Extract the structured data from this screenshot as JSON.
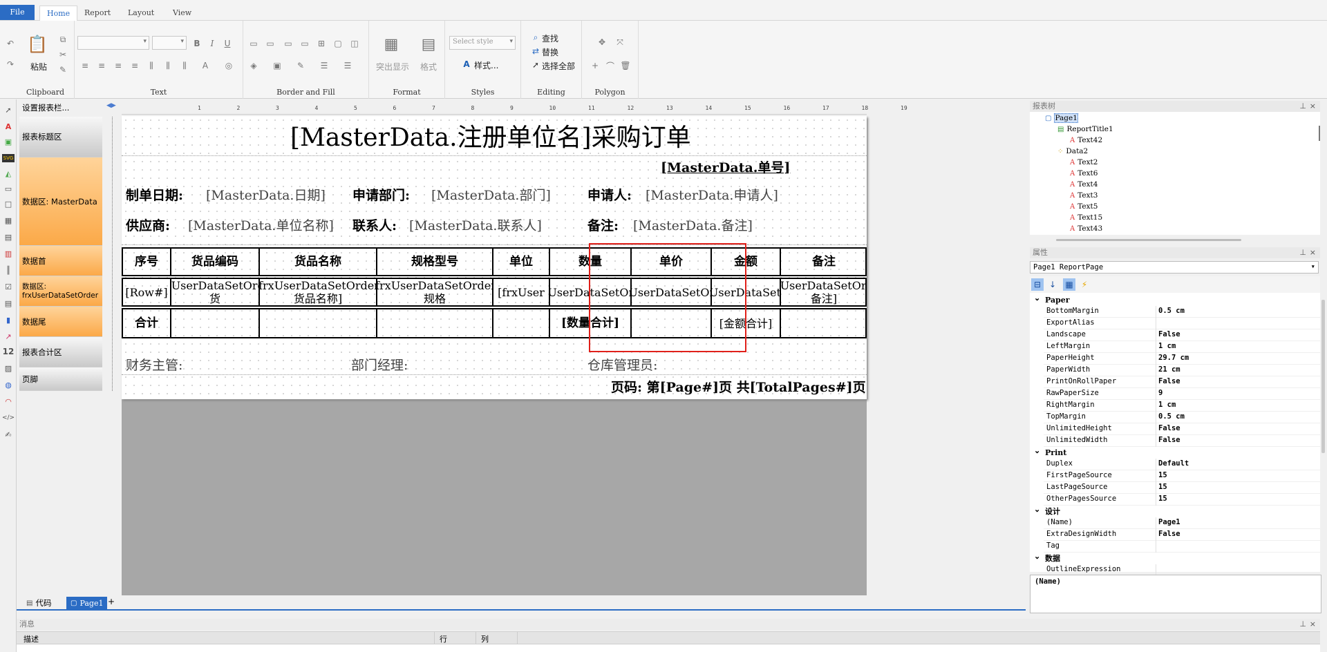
{
  "ribbon": {
    "tabs": [
      "File",
      "Home",
      "Report",
      "Layout",
      "View"
    ],
    "groups": {
      "clipboard": {
        "label": "Clipboard",
        "paste": "粘贴"
      },
      "text": {
        "label": "Text"
      },
      "border": {
        "label": "Border and Fill"
      },
      "format": {
        "label": "Format",
        "highlight": "突出显示",
        "format": "格式"
      },
      "styles": {
        "label": "Styles",
        "select_placeholder": "Select style",
        "styles_btn": "样式..."
      },
      "editing": {
        "label": "Editing",
        "find": "查找",
        "replace": "替换",
        "select_all": "选择全部"
      },
      "polygon": {
        "label": "Polygon"
      }
    }
  },
  "bands": {
    "header_label": "设置报表栏...",
    "items": [
      "报表标题区",
      "数据区: MasterData",
      "数据首",
      "数据区: frxUserDataSetOrder",
      "数据尾",
      "报表合计区",
      "页脚"
    ]
  },
  "ruler": [
    "1",
    "2",
    "3",
    "4",
    "5",
    "6",
    "7",
    "8",
    "9",
    "10",
    "11",
    "12",
    "13",
    "14",
    "15",
    "16",
    "17",
    "18",
    "19"
  ],
  "report": {
    "title": "[MasterData.注册单位名]采购订单",
    "order_no": "[MasterData.单号]",
    "fields": {
      "date_label": "制单日期:",
      "date_value": "[MasterData.日期]",
      "dept_label": "申请部门:",
      "dept_value": "[MasterData.部门]",
      "applicant_label": "申请人:",
      "applicant_value": "[MasterData.申请人]",
      "supplier_label": "供应商:",
      "supplier_value": "[MasterData.单位名称]",
      "contact_label": "联系人:",
      "contact_value": "[MasterData.联系人]",
      "remark_label": "备注:",
      "remark_value": "[MasterData.备注]"
    },
    "table_headers": [
      "序号",
      "货品编码",
      "货品名称",
      "规格型号",
      "单位",
      "数量",
      "单价",
      "金额",
      "备注"
    ],
    "row_cells": [
      "[Row#]",
      "[frxUserDataSetOrder.货",
      "[frxUserDataSetOrder.货品名称]",
      "[frxUserDataSetOrder.规格",
      "[frxUser",
      "[frxUserDataSetOrder",
      "[frxUserDataSetOrder",
      "[frxUserDataSetOrd",
      "[frxUserDataSetOrder.备注]"
    ],
    "footer": {
      "total": "合计",
      "qty_total": "[数量合计]",
      "amt_total": "[金额合计]"
    },
    "signatures": {
      "finance": "财务主管:",
      "dept_mgr": "部门经理:",
      "warehouse": "仓库管理员:"
    },
    "page_footer": "页码: 第[Page#]页 共[TotalPages#]页"
  },
  "tree": {
    "title": "报表树",
    "nodes": [
      "Page1",
      "ReportTitle1",
      "Text42",
      "Data2",
      "Text2",
      "Text6",
      "Text4",
      "Text3",
      "Text5",
      "Text15",
      "Text43"
    ]
  },
  "properties": {
    "title": "属性",
    "object": "Page1 ReportPage",
    "categories": {
      "paper": "Paper",
      "paper_rows": [
        {
          "k": "BottomMargin",
          "v": "0.5 cm"
        },
        {
          "k": "ExportAlias",
          "v": ""
        },
        {
          "k": "Landscape",
          "v": "False"
        },
        {
          "k": "LeftMargin",
          "v": "1 cm"
        },
        {
          "k": "PaperHeight",
          "v": "29.7 cm"
        },
        {
          "k": "PaperWidth",
          "v": "21 cm"
        },
        {
          "k": "PrintOnRollPaper",
          "v": "False"
        },
        {
          "k": "RawPaperSize",
          "v": "9"
        },
        {
          "k": "RightMargin",
          "v": "1 cm"
        },
        {
          "k": "TopMargin",
          "v": "0.5 cm"
        },
        {
          "k": "UnlimitedHeight",
          "v": "False"
        },
        {
          "k": "UnlimitedWidth",
          "v": "False"
        }
      ],
      "print": "Print",
      "print_rows": [
        {
          "k": "Duplex",
          "v": "Default"
        },
        {
          "k": "FirstPageSource",
          "v": "15"
        },
        {
          "k": "LastPageSource",
          "v": "15"
        },
        {
          "k": "OtherPagesSource",
          "v": "15"
        }
      ],
      "design": "设计",
      "design_rows": [
        {
          "k": "(Name)",
          "v": "Page1"
        },
        {
          "k": "ExtraDesignWidth",
          "v": "False"
        },
        {
          "k": "Tag",
          "v": ""
        }
      ],
      "data": "数据",
      "data_rows": [
        {
          "k": "OutlineExpression",
          "v": ""
        }
      ]
    },
    "desc_title": "(Name)"
  },
  "bottom_tabs": {
    "code": "代码",
    "page": "Page1",
    "add": "+"
  },
  "messages": {
    "title": "消息",
    "col_desc": "描述",
    "col_row": "行",
    "col_col": "列"
  }
}
